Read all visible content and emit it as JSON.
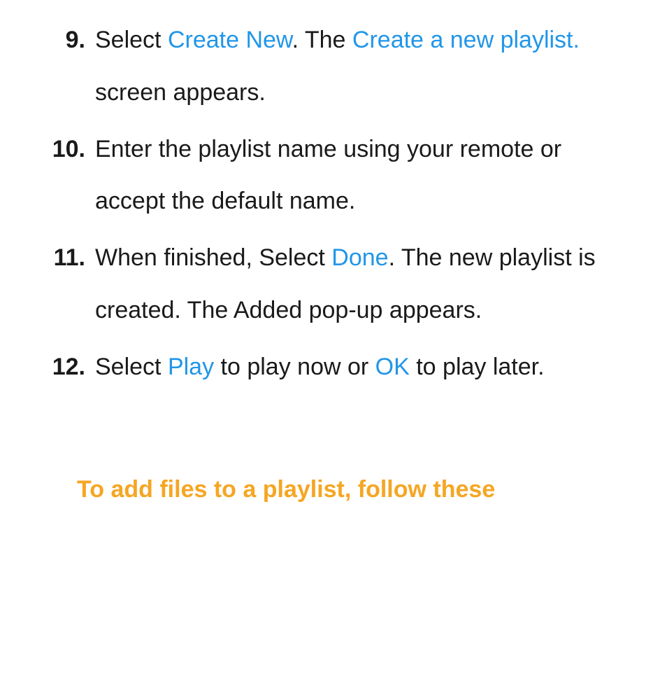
{
  "steps": [
    {
      "number": "9.",
      "segments": [
        {
          "text": "Select ",
          "type": "plain"
        },
        {
          "text": "Create New",
          "type": "blue"
        },
        {
          "text": ". The ",
          "type": "plain"
        },
        {
          "text": "Create a new playlist.",
          "type": "blue"
        },
        {
          "text": " screen appears.",
          "type": "plain"
        }
      ]
    },
    {
      "number": "10.",
      "segments": [
        {
          "text": "Enter the playlist name using your remote or accept the default name.",
          "type": "plain"
        }
      ]
    },
    {
      "number": "11.",
      "segments": [
        {
          "text": "When finished, Select ",
          "type": "plain"
        },
        {
          "text": "Done",
          "type": "blue"
        },
        {
          "text": ". The new playlist is created. The Added pop-up appears.",
          "type": "plain"
        }
      ]
    },
    {
      "number": "12.",
      "segments": [
        {
          "text": "Select ",
          "type": "plain"
        },
        {
          "text": "Play",
          "type": "blue"
        },
        {
          "text": " to play now or ",
          "type": "plain"
        },
        {
          "text": "OK",
          "type": "blue"
        },
        {
          "text": " to play later.",
          "type": "plain"
        }
      ]
    }
  ],
  "heading": "To add files to a playlist, follow these"
}
